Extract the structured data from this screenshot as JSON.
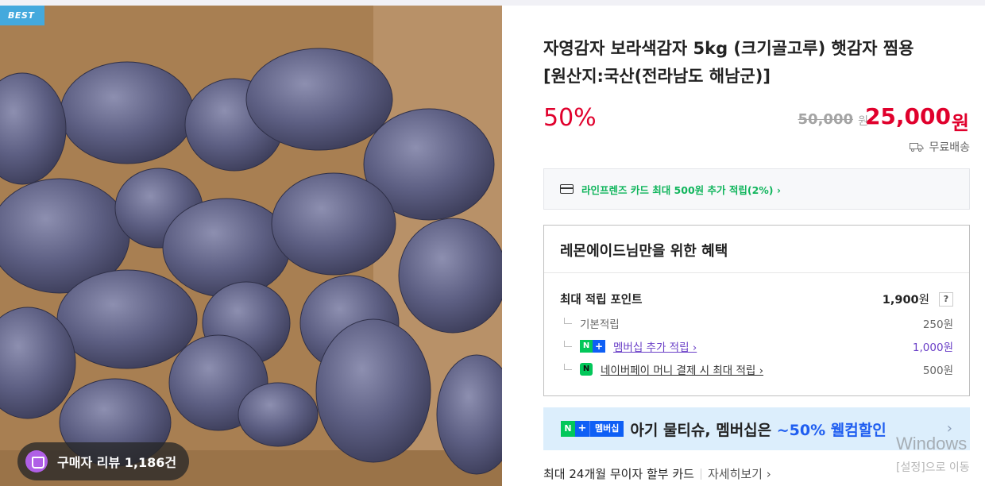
{
  "image": {
    "badge": "BEST",
    "review_label": "구매자 리뷰 1,186건"
  },
  "product": {
    "title_line1": "자영감자 보라색감자 5kg (크기골고루) 햇감자 찜용",
    "title_line2": "[원산지:국산(전라남도 해남군)]",
    "discount": "50%",
    "original_price": "50,000",
    "original_unit": "원",
    "sale_price": "25,000",
    "sale_unit": "원",
    "shipping": "무료배송"
  },
  "card_promo": {
    "text": "라인프렌즈 카드 최대 500원 추가 적립(2%) ›"
  },
  "benefits": {
    "heading": "레몬에이드님만을 위한 혜택",
    "max_label": "최대 적립 포인트",
    "max_value": "1,900",
    "max_unit": "원",
    "help": "?",
    "base_label": "기본적립",
    "base_value": "250원",
    "member_label": "멤버십 추가 적립 ›",
    "member_value": "1,000원",
    "pay_label": "네이버페이 머니 결제 시 최대 적립 ›",
    "pay_value": "500원"
  },
  "promo_banner": {
    "badge_n": "N",
    "badge_plus": "+",
    "badge_text": "멤버십",
    "text_main": "아기 물티슈, 멤버십은 ",
    "text_highlight": "~50% 웰컴할인",
    "arrow": "›"
  },
  "installment": {
    "text": "최대 24개월 무이자 할부 카드",
    "link": "자세히보기 ›"
  },
  "os_watermark": {
    "line1": "Windows",
    "line2": "[설정]으로 이동"
  },
  "colors": {
    "accent_red": "#e0002c",
    "naver_green": "#03c75a",
    "membership_blue": "#0e5ff5",
    "promo_bg": "#dceefc"
  }
}
